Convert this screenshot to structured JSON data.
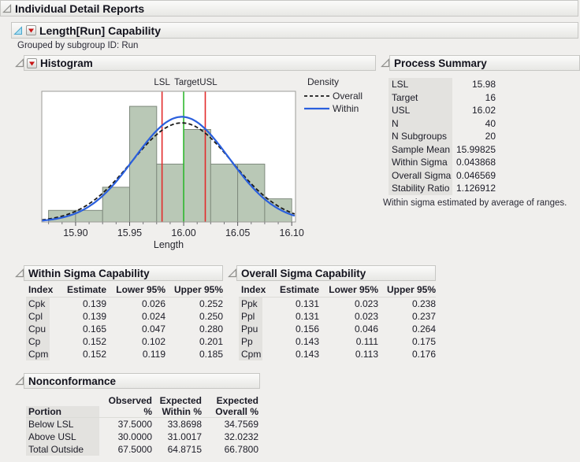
{
  "report": {
    "title": "Individual Detail Reports",
    "capability_title": "Length[Run] Capability",
    "grouped_by": "Grouped by subgroup ID: Run"
  },
  "sections": {
    "histogram": "Histogram",
    "process_summary": "Process Summary",
    "within_capability": "Within Sigma Capability",
    "overall_capability": "Overall Sigma Capability",
    "nonconformance": "Nonconformance"
  },
  "chart_data": {
    "type": "histogram",
    "xlabel": "Length",
    "x_tick_labels": [
      "15.90",
      "15.95",
      "16.00",
      "16.05",
      "16.10"
    ],
    "x_ticks": [
      15.9,
      15.95,
      16.0,
      16.05,
      16.1
    ],
    "minor_tick_step": 0.0125,
    "x_range": [
      15.8687,
      16.1035
    ],
    "y_max": 11.3,
    "n": 40,
    "bin_start": 15.875,
    "bin_width": 0.025,
    "counts": [
      1,
      1,
      3,
      10,
      5,
      8,
      5,
      5,
      2
    ],
    "bar_fill": "#b9c8b6",
    "bar_stroke": "#7f8a7d",
    "spec_lines": [
      {
        "label": "LSL",
        "value": 15.98,
        "color": "#e32b2b"
      },
      {
        "label": "Target",
        "value": 16,
        "color": "#2eb82e"
      },
      {
        "label": "USL",
        "value": 16.02,
        "color": "#e32b2b"
      }
    ],
    "curves": [
      {
        "name": "Overall",
        "mean": 15.99825,
        "sigma": 0.046569,
        "style": "dashed",
        "color": "#1a1a1a"
      },
      {
        "name": "Within",
        "mean": 15.99825,
        "sigma": 0.043868,
        "style": "solid",
        "color": "#2a5fdd"
      }
    ],
    "legend": {
      "title": "Density",
      "entries": [
        "Overall",
        "Within"
      ]
    }
  },
  "process_summary": {
    "rows": [
      {
        "label": "LSL",
        "value": "15.98"
      },
      {
        "label": "Target",
        "value": "16"
      },
      {
        "label": "USL",
        "value": "16.02"
      },
      {
        "label": "N",
        "value": "40"
      },
      {
        "label": "N Subgroups",
        "value": "20"
      },
      {
        "label": "Sample Mean",
        "value": "15.99825"
      },
      {
        "label": "Within Sigma",
        "value": "0.043868"
      },
      {
        "label": "Overall Sigma",
        "value": "0.046569"
      },
      {
        "label": "Stability Ratio",
        "value": "1.126912"
      }
    ],
    "note": "Within sigma estimated by average of ranges."
  },
  "within_capability": {
    "headers": [
      "Index",
      "Estimate",
      "Lower 95%",
      "Upper 95%"
    ],
    "rows": [
      {
        "index": "Cpk",
        "estimate": "0.139",
        "lower": "0.026",
        "upper": "0.252"
      },
      {
        "index": "Cpl",
        "estimate": "0.139",
        "lower": "0.024",
        "upper": "0.250"
      },
      {
        "index": "Cpu",
        "estimate": "0.165",
        "lower": "0.047",
        "upper": "0.280"
      },
      {
        "index": "Cp",
        "estimate": "0.152",
        "lower": "0.102",
        "upper": "0.201"
      },
      {
        "index": "Cpm",
        "estimate": "0.152",
        "lower": "0.119",
        "upper": "0.185"
      }
    ]
  },
  "overall_capability": {
    "headers": [
      "Index",
      "Estimate",
      "Lower 95%",
      "Upper 95%"
    ],
    "rows": [
      {
        "index": "Ppk",
        "estimate": "0.131",
        "lower": "0.023",
        "upper": "0.238"
      },
      {
        "index": "Ppl",
        "estimate": "0.131",
        "lower": "0.023",
        "upper": "0.237"
      },
      {
        "index": "Ppu",
        "estimate": "0.156",
        "lower": "0.046",
        "upper": "0.264"
      },
      {
        "index": "Pp",
        "estimate": "0.143",
        "lower": "0.111",
        "upper": "0.175"
      },
      {
        "index": "Cpm",
        "estimate": "0.143",
        "lower": "0.113",
        "upper": "0.176"
      }
    ]
  },
  "nonconformance": {
    "headers": [
      "Portion",
      "Observed %",
      "Expected\nWithin %",
      "Expected\nOverall %"
    ],
    "rows": [
      {
        "portion": "Below LSL",
        "observed": "37.5000",
        "expected_within": "33.8698",
        "expected_overall": "34.7569"
      },
      {
        "portion": "Above USL",
        "observed": "30.0000",
        "expected_within": "31.0017",
        "expected_overall": "32.0232"
      },
      {
        "portion": "Total Outside",
        "observed": "67.5000",
        "expected_within": "64.8715",
        "expected_overall": "66.7800"
      }
    ]
  }
}
